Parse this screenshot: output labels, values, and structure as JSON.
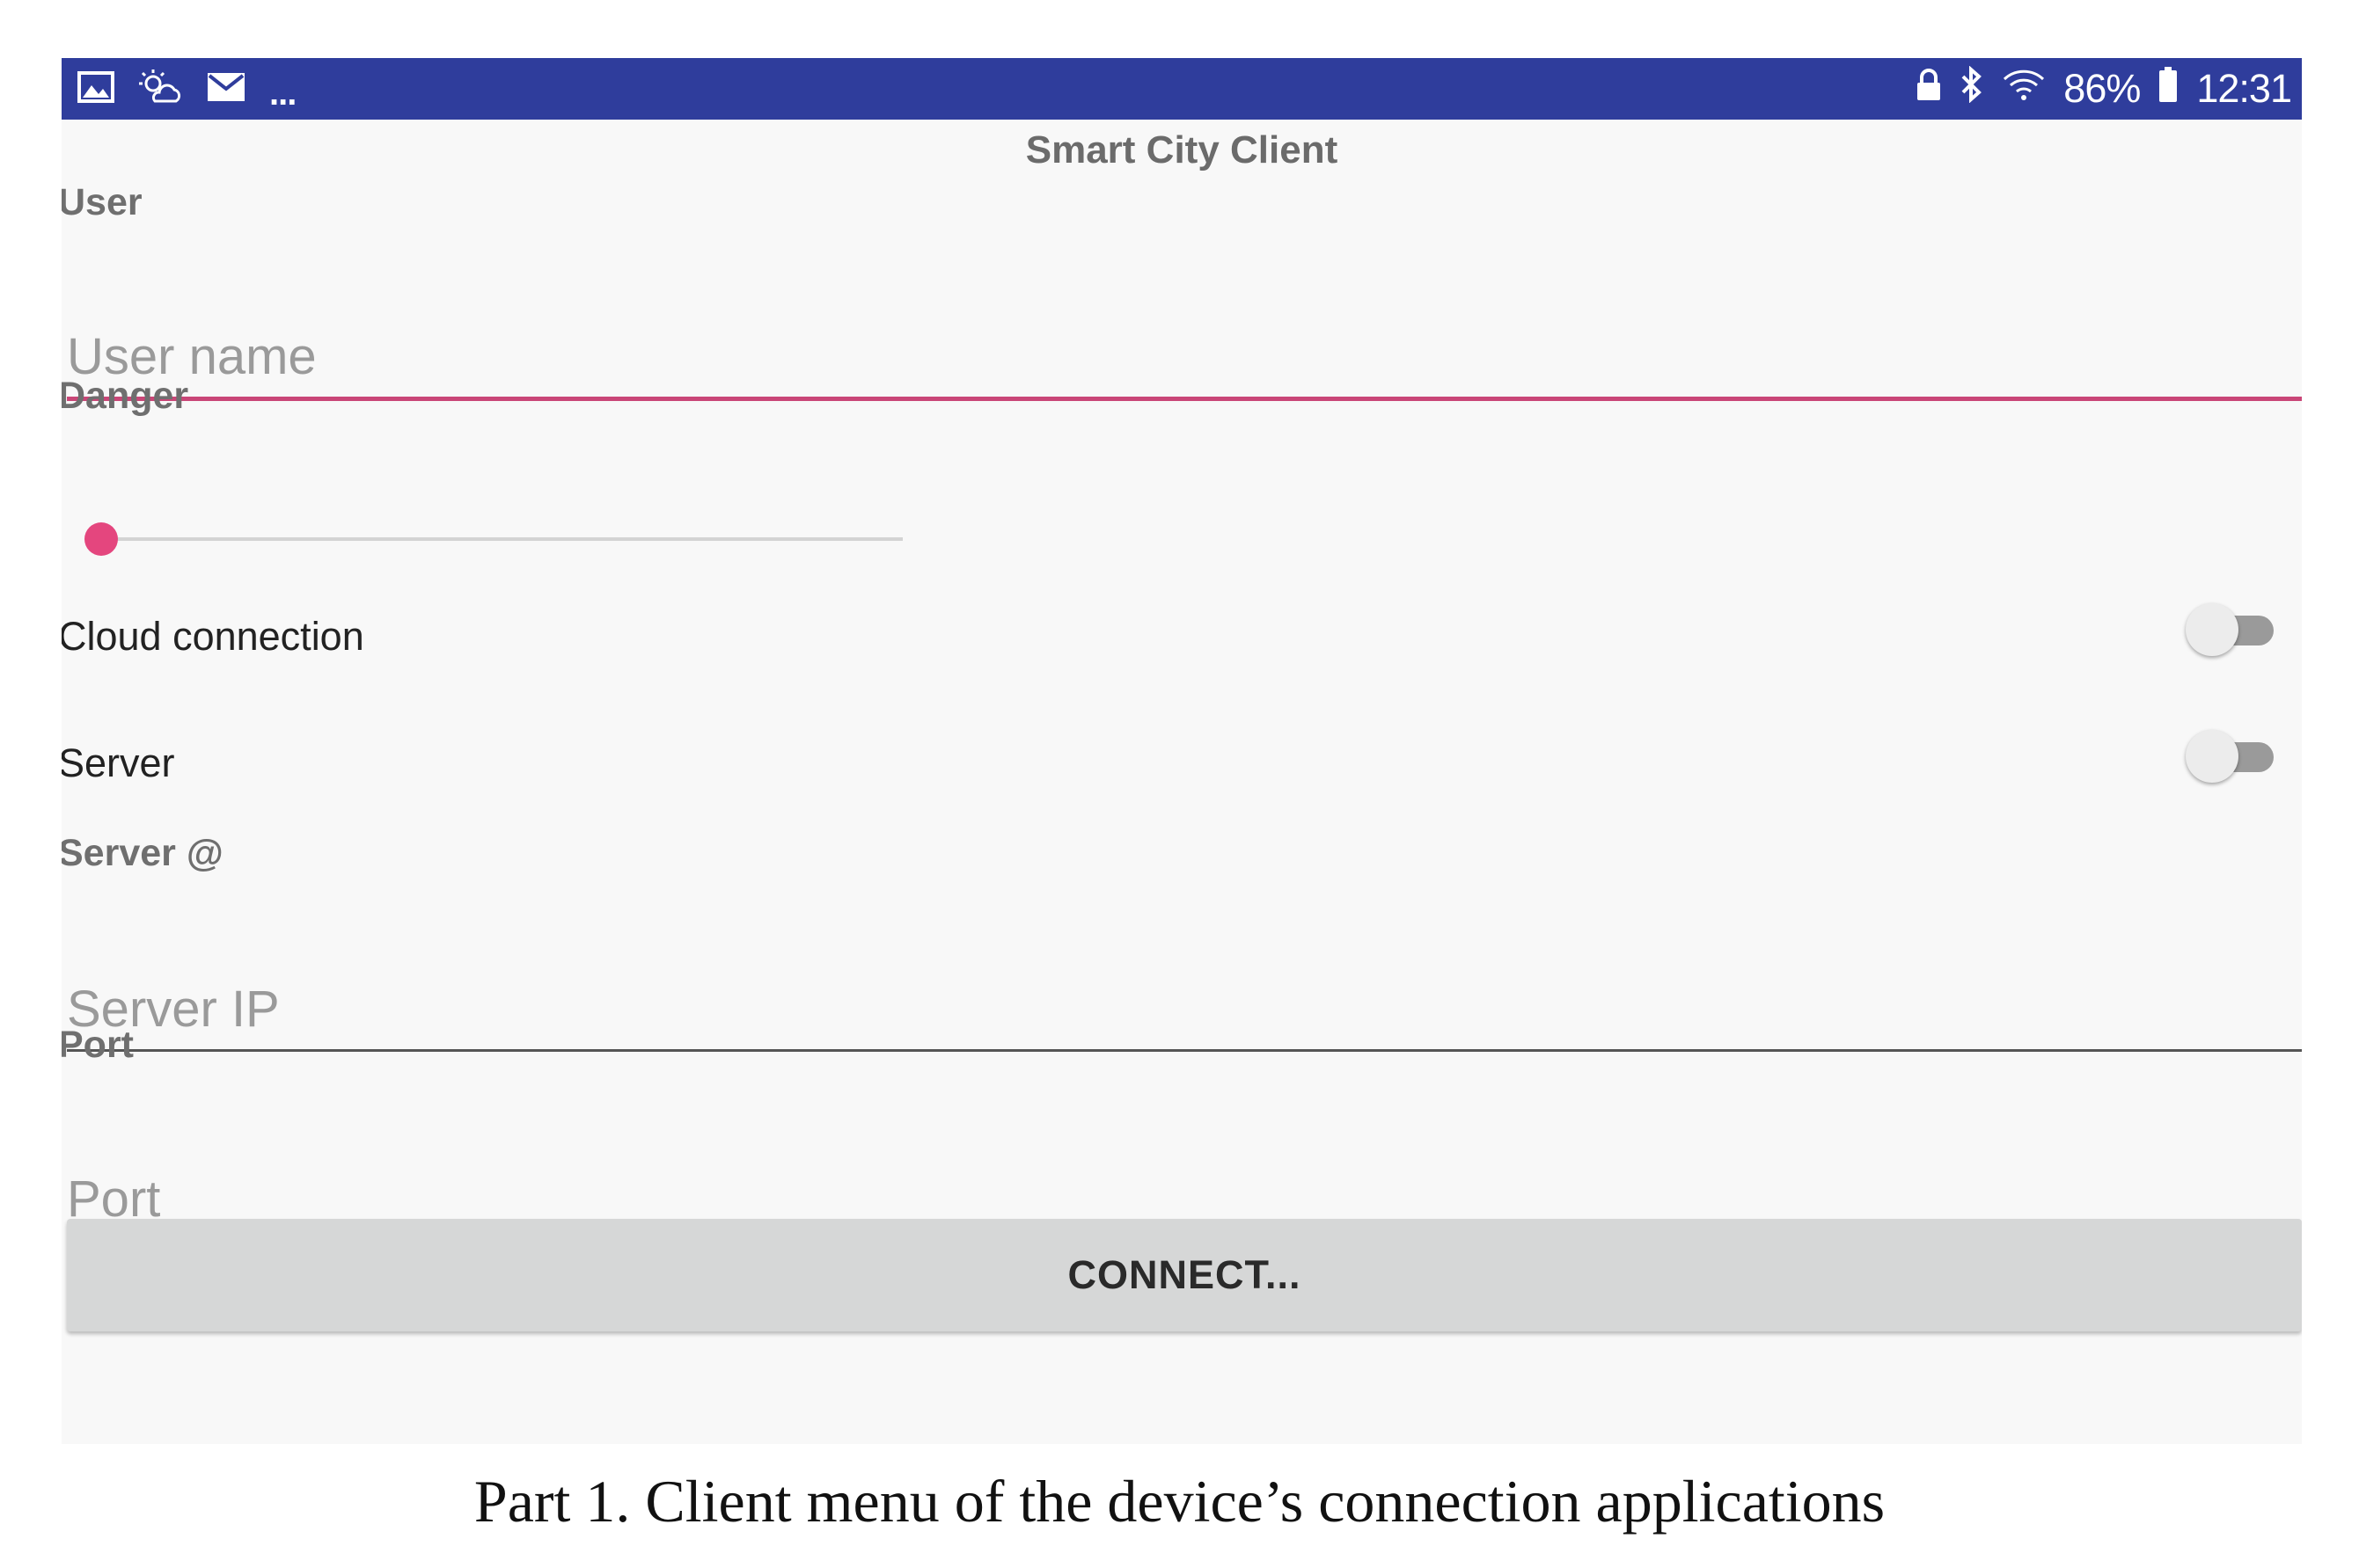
{
  "status_bar": {
    "more": "...",
    "battery_percent": "86%",
    "time": "12:31",
    "icons_left": [
      "gallery-icon",
      "weather-icon",
      "mail-icon"
    ],
    "icons_right": [
      "lock-icon",
      "bluetooth-icon",
      "wifi-icon",
      "battery-icon"
    ]
  },
  "app": {
    "title": "Smart City Client"
  },
  "form": {
    "user_label": "User",
    "user_placeholder": "User name",
    "danger_label": "Danger",
    "danger_value": 0,
    "cloud_label": "Cloud connection",
    "cloud_on": false,
    "server_label": "Server",
    "server_on": false,
    "server_addr_label": "Server @",
    "server_ip_placeholder": "Server IP",
    "port_label": "Port",
    "port_placeholder": "Port",
    "connect_label": "CONNECT..."
  },
  "colors": {
    "status_bar": "#2f3d9c",
    "accent": "#e4467e",
    "focused_underline": "#c94677",
    "background": "#f8f8f8",
    "button": "#d6d7d7"
  },
  "caption": "Part 1. Client menu of the device’s connection applications"
}
